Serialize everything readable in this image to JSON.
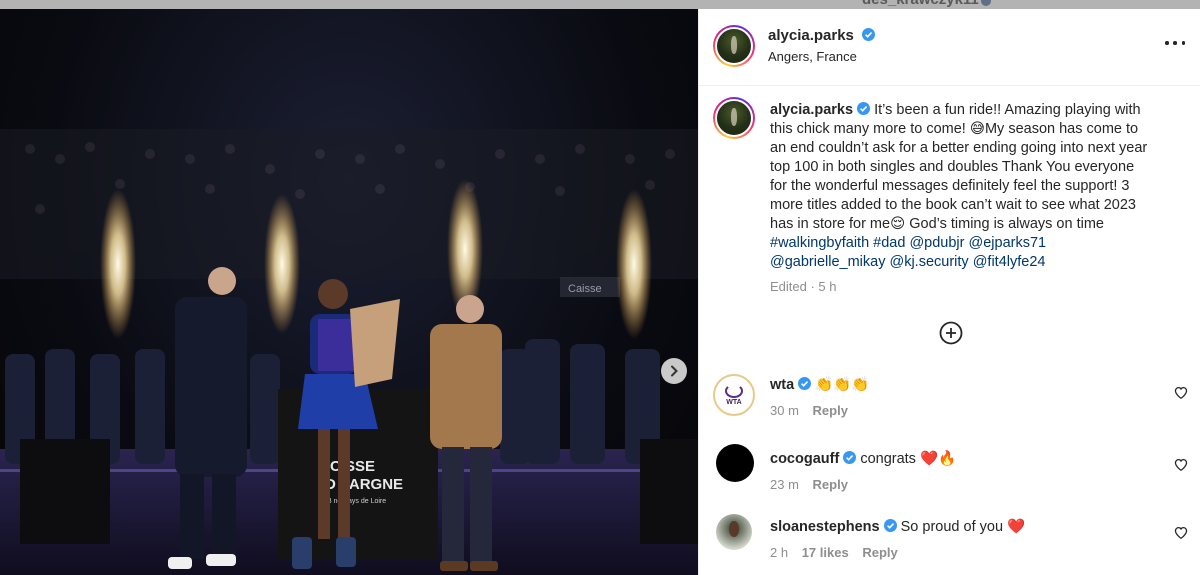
{
  "background_hint": {
    "username": "des_krawczyk11"
  },
  "post": {
    "author": "alycia.parks",
    "location": "Angers, France",
    "caption": {
      "author": "alycia.parks",
      "text_lines": [
        "It’s been a fun ride!! Amazing playing with",
        "this chick many more to come! 😅My season has come to",
        "an end couldn’t ask for a better ending going into next year",
        "top 100 in both singles and doubles Thank You everyone",
        "for the wonderful messages definitely feel the support! 3",
        "more titles added to the book can’t wait to see what 2023",
        "has in store for me😌 God’s timing is always on time"
      ],
      "tags_line1": "#walkingbyfaith #dad @pdubjr @ejparks71",
      "tags_line2": "@gabrielle_mikay @kj.security @fit4lyfe24",
      "edited": "Edited · 5 h"
    },
    "photo": {
      "banner_line1": "C  SSE",
      "banner_line2": "D  PARGNE",
      "banner_line3": "B      ne Pays de Loire",
      "sign_text": "Caisse"
    }
  },
  "comments": [
    {
      "user": "wta",
      "text": "👏👏👏",
      "time": "30 m",
      "likes": "",
      "reply": "Reply",
      "avatar_text": "WTA"
    },
    {
      "user": "cocogauff",
      "text": "congrats ❤️🔥",
      "time": "23 m",
      "likes": "",
      "reply": "Reply"
    },
    {
      "user": "sloanestephens",
      "text": "So proud of you ❤️",
      "time": "2 h",
      "likes": "17 likes",
      "reply": "Reply"
    }
  ],
  "colors": {
    "verified": "#3897f0",
    "link": "#00376b",
    "muted": "#8e8e8e",
    "text": "#262626"
  },
  "icons": [
    "verified-badge-icon",
    "more-options-icon",
    "add-comment-icon",
    "heart-icon",
    "next-arrow-icon"
  ]
}
